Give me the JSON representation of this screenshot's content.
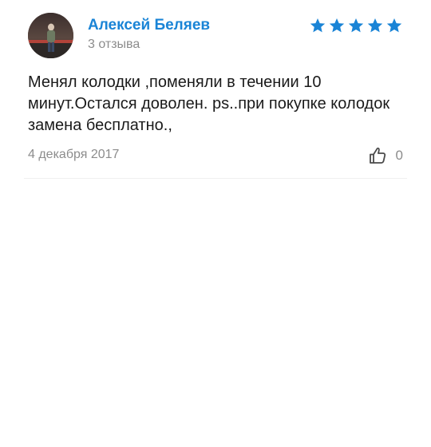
{
  "review": {
    "author_name": "Алексей Беляев",
    "review_count": "3 отзыва",
    "rating": 5,
    "rating_color": "#1a84d6",
    "text": "Менял колодки ,поменяли в течении 10 минут.Остался доволен. ps..при покупке колодок замена бесплатно.,",
    "date": "4 декабря 2017",
    "likes": "0",
    "icons": {
      "like": "thumbs-up-icon",
      "star": "star-icon"
    }
  }
}
